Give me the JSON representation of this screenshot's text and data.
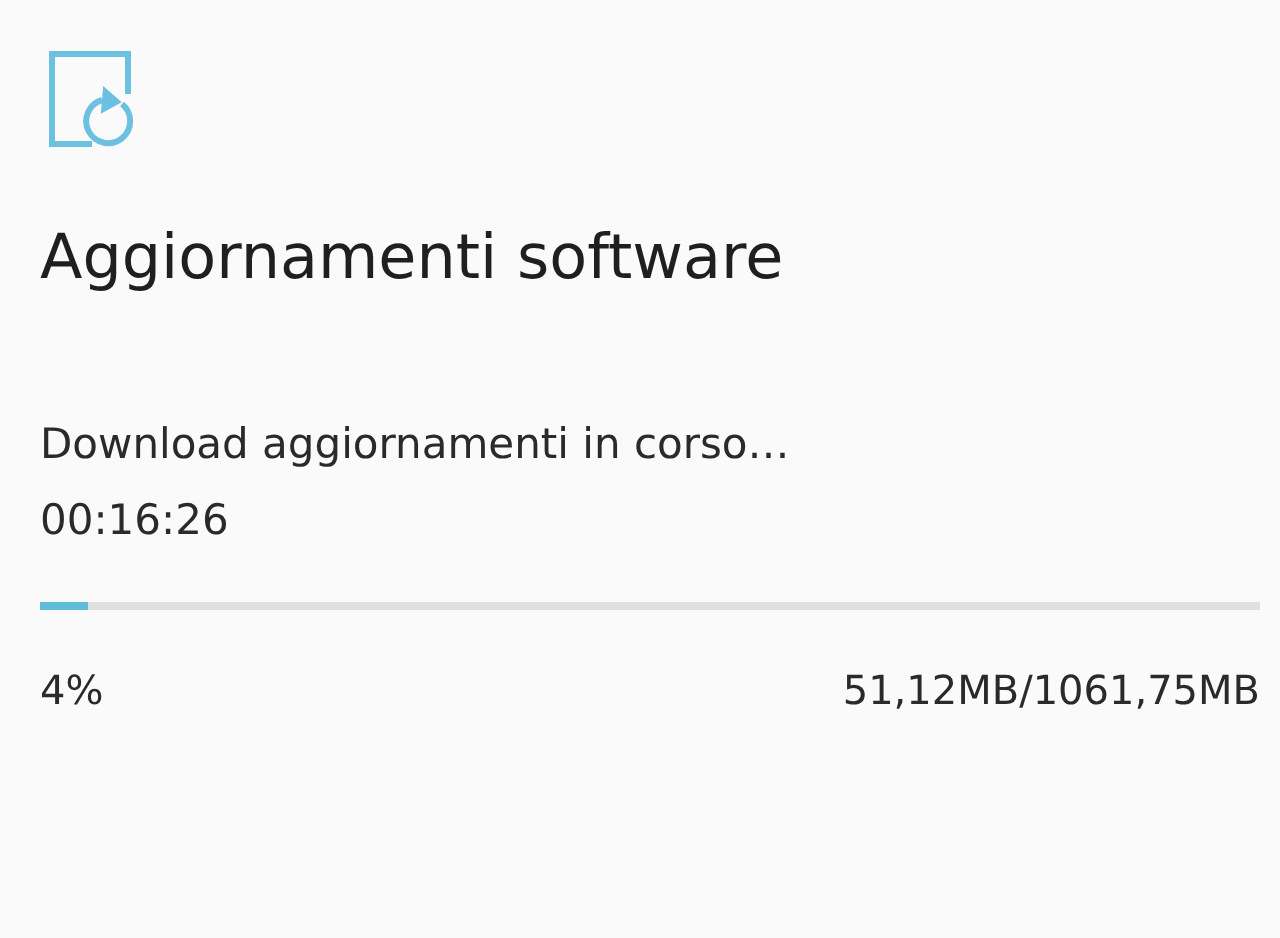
{
  "title": "Aggiornamenti software",
  "download": {
    "status": "Download aggiornamenti in corso…",
    "time": "00:16:26",
    "level": 0.04,
    "percent": "4%",
    "size": "51,12MB/1061,75MB"
  }
}
